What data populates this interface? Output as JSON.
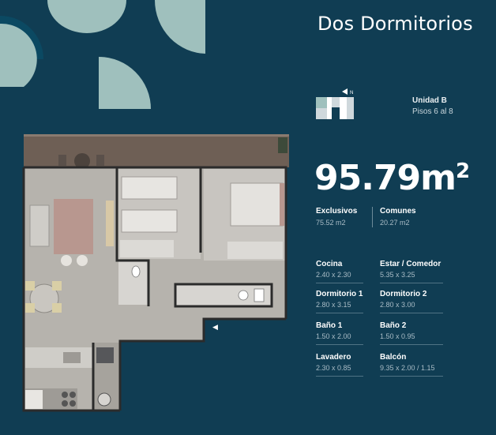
{
  "title": "Dos Dormitorios",
  "unit": {
    "name": "Unidad B",
    "floors": "Pisos 6 al 8",
    "north": "N"
  },
  "area": {
    "value": "95.79m",
    "sup": "2"
  },
  "summary": [
    {
      "label": "Exclusivos",
      "value": "75.52 m2"
    },
    {
      "label": "Comunes",
      "value": "20.27 m2"
    }
  ],
  "rooms": [
    {
      "label": "Cocina",
      "value": "2.40 x 2.30"
    },
    {
      "label": "Estar / Comedor",
      "value": "5.35 x 3.25"
    },
    {
      "label": "Dormitorio 1",
      "value": "2.80 x 3.15"
    },
    {
      "label": "Dormitorio 2",
      "value": "2.80 x 3.00"
    },
    {
      "label": "Baño 1",
      "value": "1.50 x 2.00"
    },
    {
      "label": "Baño 2",
      "value": "1.50 x 0.95"
    },
    {
      "label": "Lavadero",
      "value": "2.30 x 0.85"
    },
    {
      "label": "Balcón",
      "value": "9.35 x 2.00 / 1.15"
    }
  ],
  "colors": {
    "background": "#103d53",
    "accent": "#9fc0bd",
    "wall": "#2b2b2b",
    "floor": "#b6b3ad",
    "deck": "#6e5f55"
  },
  "icons": {
    "entrance": "entrance-arrow-icon",
    "compass": "north-arrow-icon"
  }
}
